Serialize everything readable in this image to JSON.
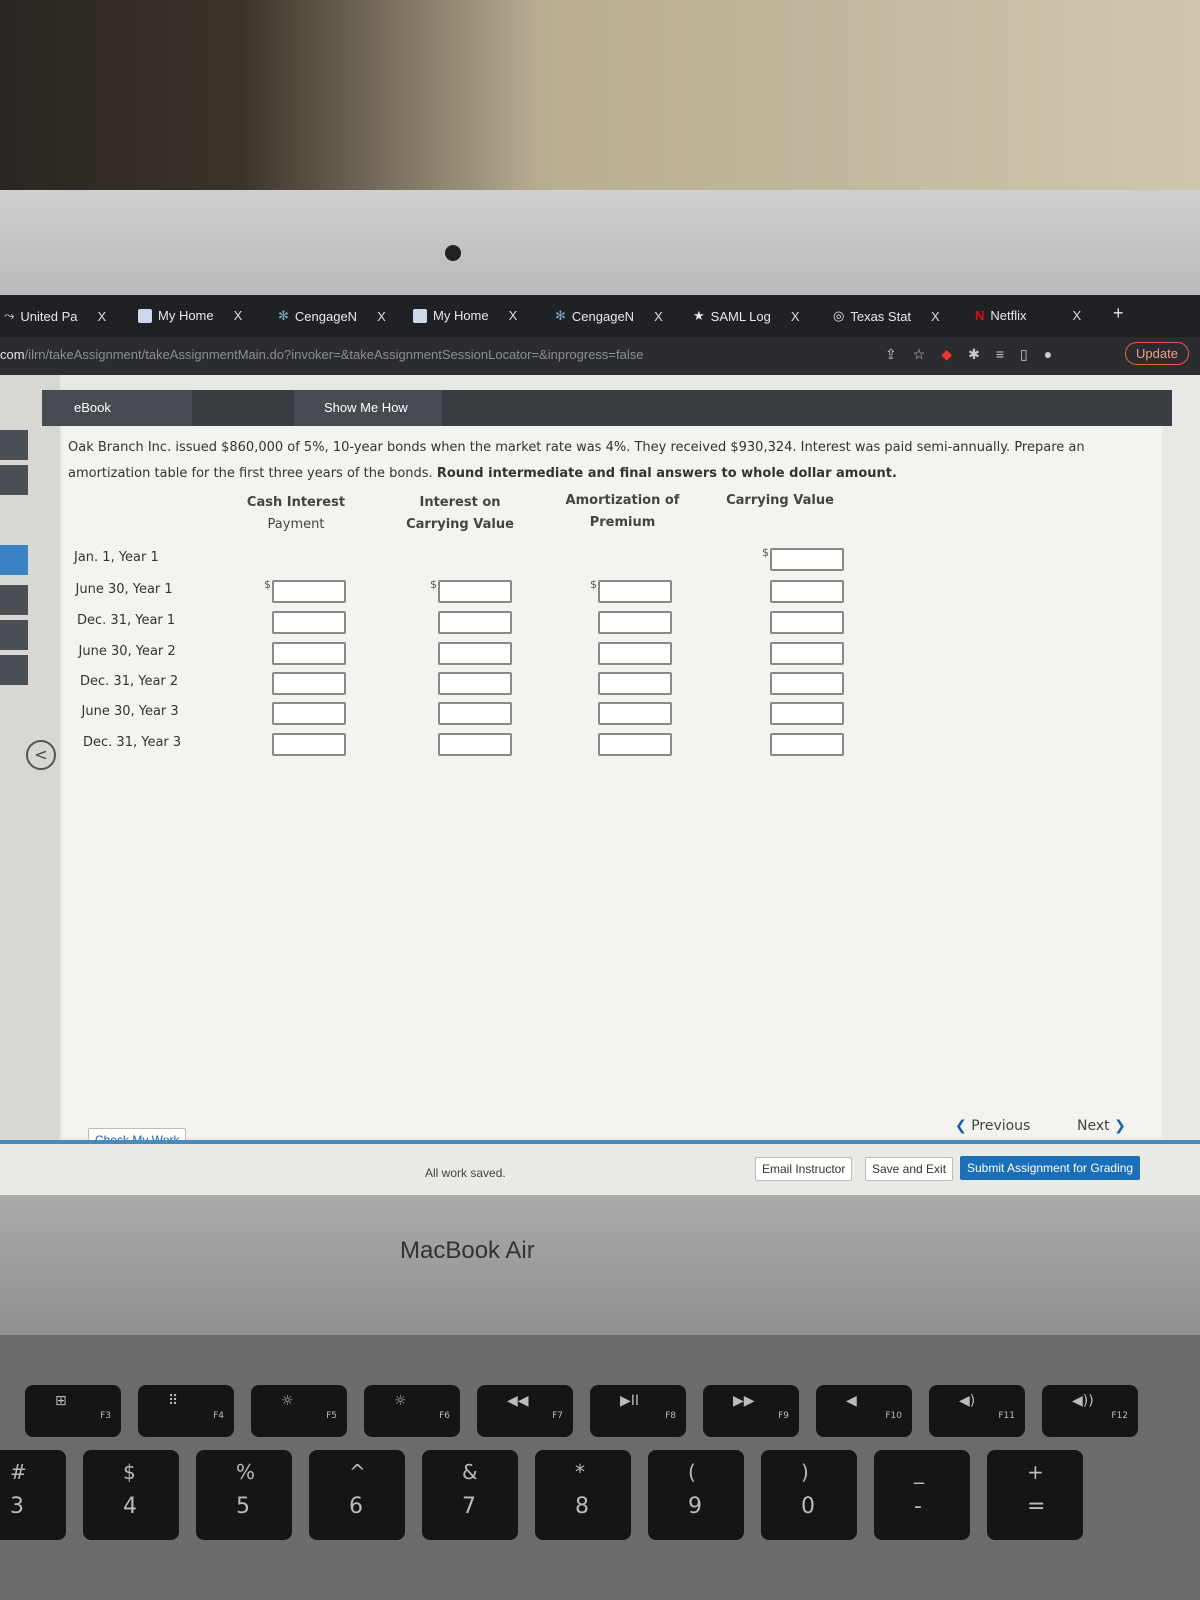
{
  "browser": {
    "tabs": [
      {
        "label": "United Pa"
      },
      {
        "label": "My Home"
      },
      {
        "label": "CengageN"
      },
      {
        "label": "My Home"
      },
      {
        "label": "CengageN"
      },
      {
        "label": "SAML Log"
      },
      {
        "label": "Texas Stat"
      },
      {
        "label": "Netflix"
      }
    ],
    "close_glyph": "X",
    "new_tab": "+",
    "url_domain": "com",
    "url_path": "/ilrn/takeAssignment/takeAssignmentMain.do?invoker=&takeAssignmentSessionLocator=&inprogress=false",
    "update_label": "Update"
  },
  "toolbar": {
    "ebook": "eBook",
    "show_me_how": "Show Me How"
  },
  "question": {
    "text": "Oak Branch Inc. issued $860,000 of 5%, 10-year bonds when the market rate was 4%. They received $930,324. Interest was paid semi-annually. Prepare an amortization table for the first three years of the bonds. ",
    "bold": "Round intermediate and final answers to whole dollar amount."
  },
  "table": {
    "headers": [
      {
        "l1": "Cash Interest",
        "l2": "Payment"
      },
      {
        "l1": "Interest on",
        "l2": "Carrying Value"
      },
      {
        "l1": "Amortization of",
        "l2": "Premium"
      },
      {
        "l1": "",
        "l2": "Carrying Value"
      }
    ],
    "rows": [
      "Jan. 1, Year 1",
      "June 30, Year 1",
      "Dec. 31, Year 1",
      "June 30, Year 2",
      "Dec. 31, Year 2",
      "June 30, Year 3",
      "Dec. 31, Year 3"
    ],
    "currency": "$"
  },
  "actions": {
    "check": "Check My Work",
    "previous": "Previous",
    "next": "Next",
    "saved": "All work saved.",
    "email": "Email Instructor",
    "save_exit": "Save and Exit",
    "submit": "Submit Assignment for Grading"
  },
  "device": {
    "label": "MacBook Air"
  },
  "keyboard": {
    "fkeys": [
      "F3",
      "F4",
      "F5",
      "F6",
      "F7",
      "F8",
      "F9",
      "F10",
      "F11",
      "F12"
    ],
    "numkeys": [
      {
        "t": "#",
        "b": "3"
      },
      {
        "t": "$",
        "b": "4"
      },
      {
        "t": "%",
        "b": "5"
      },
      {
        "t": "^",
        "b": "6"
      },
      {
        "t": "&",
        "b": "7"
      },
      {
        "t": "*",
        "b": "8"
      },
      {
        "t": "(",
        "b": "9"
      },
      {
        "t": ")",
        "b": "0"
      },
      {
        "t": "_",
        "b": "-"
      },
      {
        "t": "+",
        "b": "="
      }
    ]
  },
  "colors": {
    "accent": "#4a8ab8",
    "tabbar": "#202124",
    "toolbar": "#3a3d42"
  }
}
